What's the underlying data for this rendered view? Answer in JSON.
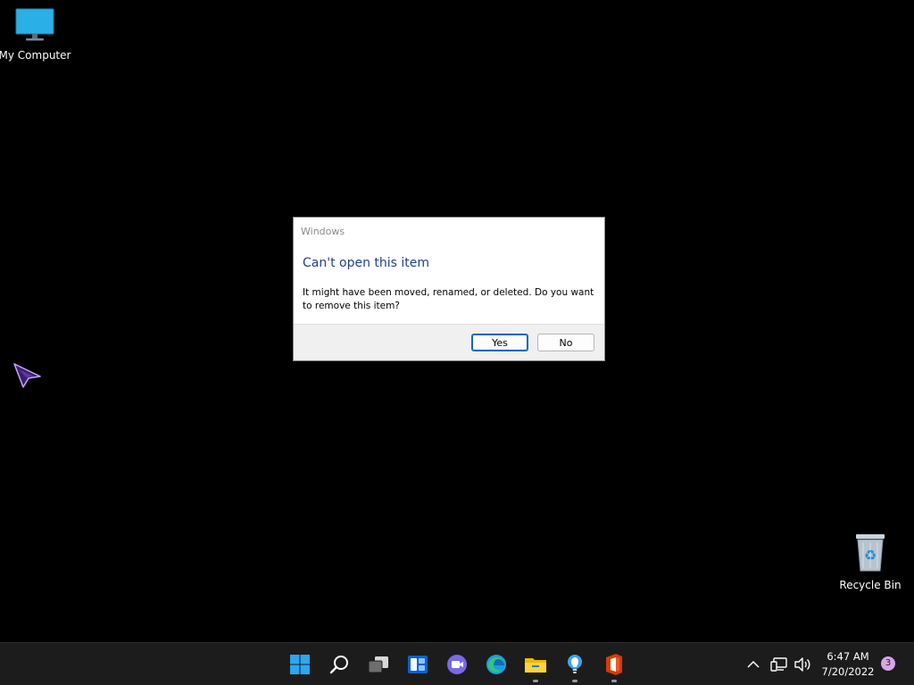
{
  "desktop": {
    "icons": [
      {
        "label": "My Computer",
        "icon": "computer-icon"
      },
      {
        "label": "Recycle Bin",
        "icon": "recycle-bin-icon"
      }
    ]
  },
  "dialog": {
    "window_title": "Windows",
    "heading": "Can't open this item",
    "message": "It might have been moved, renamed, or deleted. Do you want to remove this item?",
    "yes_label": "Yes",
    "no_label": "No",
    "heading_color": "#1f3f8f",
    "default_button_color": "#0067c0"
  },
  "taskbar": {
    "apps": [
      "windows-start-icon",
      "search-icon",
      "task-view-icon",
      "widgets-icon",
      "chat-icon",
      "edge-icon",
      "file-explorer-icon",
      "tips-icon",
      "office-icon"
    ],
    "tray": {
      "time": "6:47 AM",
      "date": "7/20/2022",
      "notification_count": "3"
    }
  }
}
